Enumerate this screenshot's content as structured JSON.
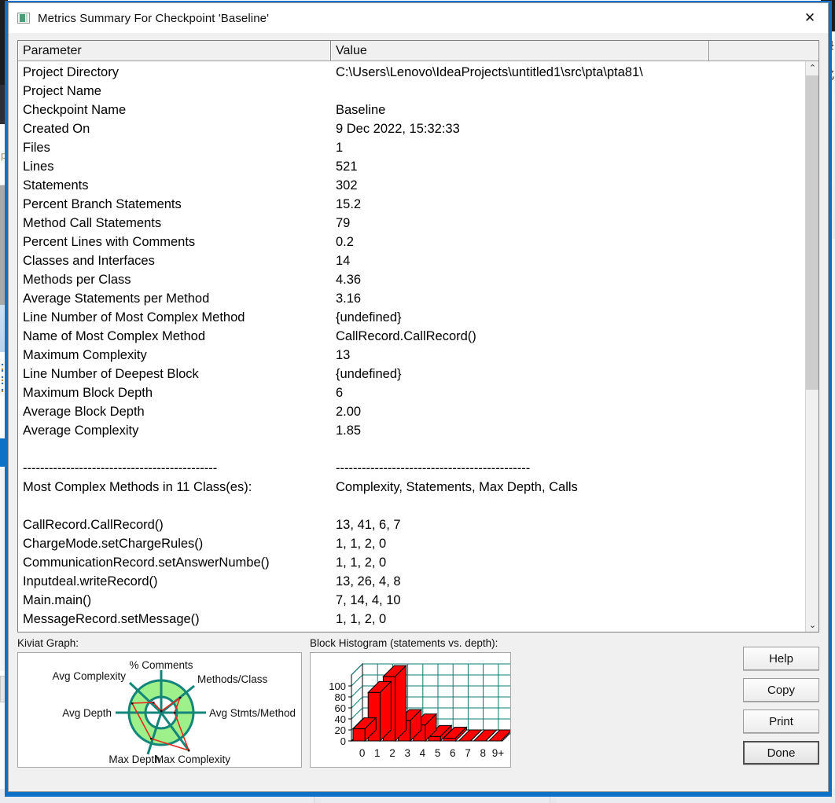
{
  "window": {
    "title": "Metrics Summary For Checkpoint 'Baseline'",
    "icon": "app-window-icon",
    "close_label": "✕"
  },
  "table": {
    "columns": [
      "Parameter",
      "Value",
      ""
    ],
    "rows": [
      {
        "parameter": "Project Directory",
        "value": "C:\\Users\\Lenovo\\IdeaProjects\\untitled1\\src\\pta\\pta81\\"
      },
      {
        "parameter": "Project Name",
        "value": ""
      },
      {
        "parameter": "Checkpoint Name",
        "value": "Baseline"
      },
      {
        "parameter": "Created On",
        "value": "9 Dec 2022, 15:32:33"
      },
      {
        "parameter": "Files",
        "value": "1"
      },
      {
        "parameter": "Lines",
        "value": "521"
      },
      {
        "parameter": "Statements",
        "value": "302"
      },
      {
        "parameter": "Percent Branch Statements",
        "value": "15.2"
      },
      {
        "parameter": "Method Call Statements",
        "value": "79"
      },
      {
        "parameter": "Percent Lines with Comments",
        "value": "0.2"
      },
      {
        "parameter": "Classes and Interfaces",
        "value": "14"
      },
      {
        "parameter": "Methods per Class",
        "value": "4.36"
      },
      {
        "parameter": "Average Statements per Method",
        "value": "3.16"
      },
      {
        "parameter": "Line Number of Most Complex Method",
        "value": "{undefined}"
      },
      {
        "parameter": "Name of Most Complex Method",
        "value": "CallRecord.CallRecord()"
      },
      {
        "parameter": "Maximum Complexity",
        "value": "13"
      },
      {
        "parameter": "Line Number of Deepest Block",
        "value": "{undefined}"
      },
      {
        "parameter": "Maximum Block Depth",
        "value": "6"
      },
      {
        "parameter": "Average Block Depth",
        "value": "2.00"
      },
      {
        "parameter": "Average Complexity",
        "value": "1.85"
      },
      {
        "parameter": "",
        "value": ""
      },
      {
        "parameter": "---------------------------------------------",
        "value": "---------------------------------------------"
      },
      {
        "parameter": "Most Complex Methods in 11 Class(es):",
        "value": "Complexity, Statements, Max Depth, Calls"
      },
      {
        "parameter": "",
        "value": ""
      },
      {
        "parameter": "CallRecord.CallRecord()",
        "value": "13, 41, 6, 7"
      },
      {
        "parameter": "ChargeMode.setChargeRules()",
        "value": "1, 1, 2, 0"
      },
      {
        "parameter": "CommunicationRecord.setAnswerNumbe()",
        "value": "1, 1, 2, 0"
      },
      {
        "parameter": "Inputdeal.writeRecord()",
        "value": "13, 26, 4, 8"
      },
      {
        "parameter": "Main.main()",
        "value": "7, 14, 4, 10"
      },
      {
        "parameter": "MessageRecord.setMessage()",
        "value": "1, 1, 2, 0"
      }
    ]
  },
  "scrollbar": {
    "up_arrow": "⌃",
    "down_arrow": "⌄"
  },
  "kiviat": {
    "label": "Kiviat Graph:",
    "axes": [
      "% Comments",
      "Methods/Class",
      "Avg Stmts/Method",
      "Max Complexity",
      "Max Depth",
      "Avg Depth",
      "Avg Complexity"
    ],
    "band_color": "#9ef08a",
    "spoke_color": "#138579",
    "series_color": "#e8261c"
  },
  "histogram": {
    "label": "Block Histogram (statements vs. depth):"
  },
  "chart_data": [
    {
      "type": "bar",
      "title": "Block Histogram (statements vs. depth)",
      "categories": [
        "0",
        "1",
        "2",
        "3",
        "4",
        "5",
        "6",
        "7",
        "8",
        "9+"
      ],
      "values": [
        22,
        88,
        117,
        37,
        29,
        8,
        5,
        0,
        0,
        0
      ],
      "xlabel": "depth",
      "ylabel": "statements",
      "ylim": [
        0,
        120
      ],
      "yticks": [
        0,
        20,
        40,
        60,
        80,
        100
      ],
      "grid": true,
      "bar_color": "#ff0000",
      "grid_color": "#0b7b72",
      "legend": "none"
    },
    {
      "type": "radar",
      "title": "Kiviat Graph",
      "categories": [
        "% Comments",
        "Methods/Class",
        "Avg Stmts/Method",
        "Max Complexity",
        "Max Depth",
        "Avg Depth",
        "Avg Complexity"
      ],
      "values": [
        0.02,
        0.55,
        0.45,
        1.35,
        0.62,
        0.72,
        0.5
      ],
      "band_inner": 0.42,
      "band_outer": 0.82,
      "ylim": [
        0,
        1.5
      ],
      "grid": false,
      "legend": "none"
    }
  ],
  "buttons": [
    {
      "label": "Help",
      "primary": false
    },
    {
      "label": "Copy",
      "primary": false
    },
    {
      "label": "Print",
      "primary": false
    },
    {
      "label": "Done",
      "primary": true
    }
  ]
}
